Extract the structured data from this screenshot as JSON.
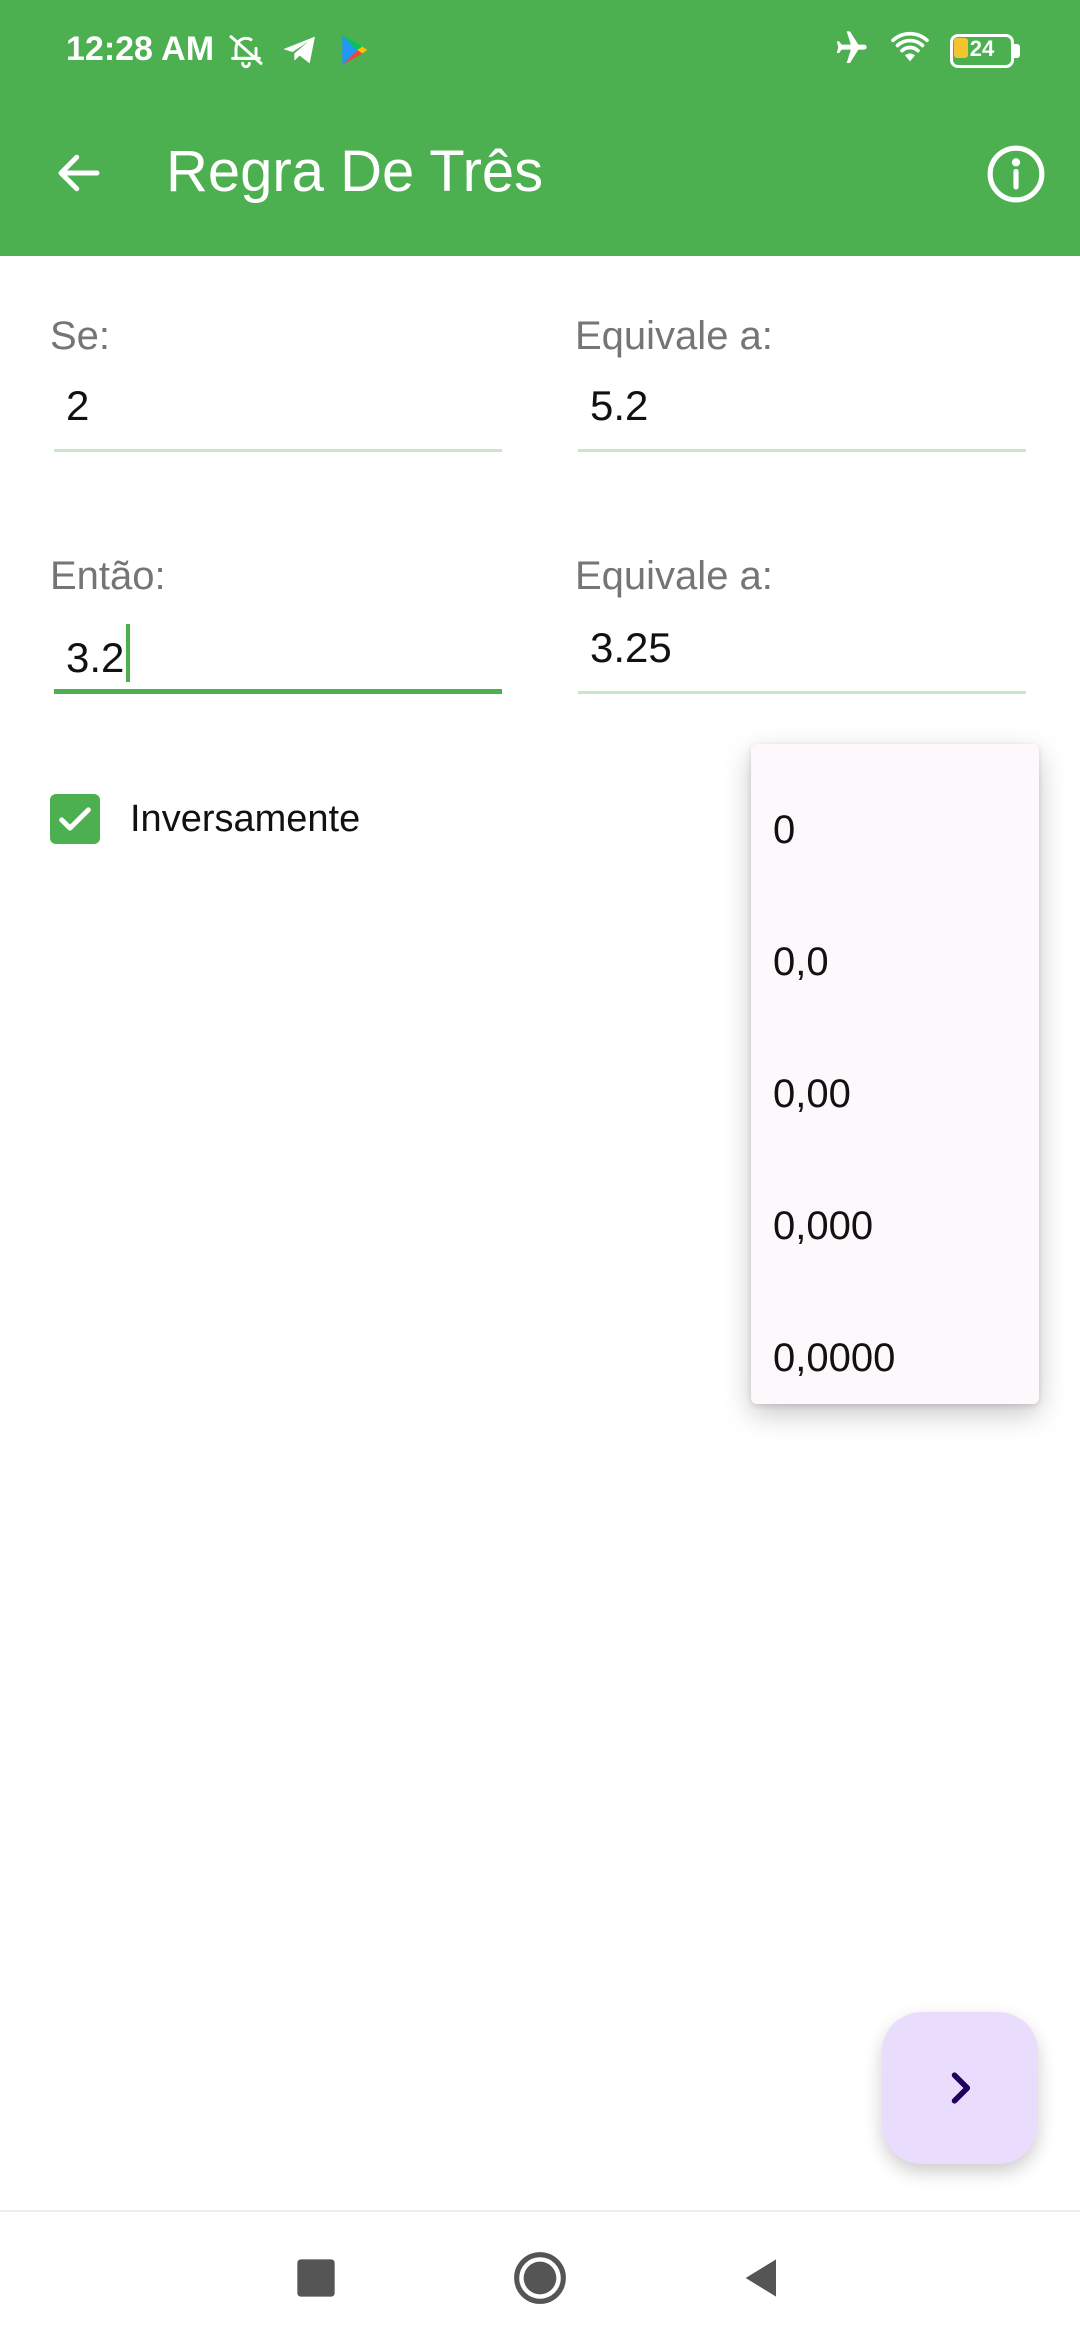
{
  "status_bar": {
    "time": "12:28 AM",
    "left_icons": [
      "muted-bell-icon",
      "telegram-icon",
      "play-store-icon"
    ],
    "right_icons": [
      "airplane-icon",
      "wifi-icon",
      "battery-icon"
    ],
    "battery_level": "24"
  },
  "app_bar": {
    "title": "Regra De Três",
    "back_icon": "arrow-left-icon",
    "info_icon": "info-icon",
    "color": "#4caf50"
  },
  "form": {
    "se_label": "Se:",
    "se_value": "2",
    "equivale1_label": "Equivale a:",
    "equivale1_value": "5.2",
    "entao_label": "Então:",
    "entao_value": "3.2",
    "equivale2_label": "Equivale a:",
    "equivale2_value": "3.25",
    "checkbox_label": "Inversamente",
    "checkbox_checked": true
  },
  "menu": {
    "items": [
      "0",
      "0,0",
      "0,00",
      "0,000",
      "0,0000"
    ]
  },
  "fab": {
    "icon": "chevron-right-icon",
    "color": "#eadcfc"
  },
  "nav_bar": {
    "icons": [
      "recents-square-icon",
      "home-circle-icon",
      "back-triangle-icon"
    ]
  }
}
